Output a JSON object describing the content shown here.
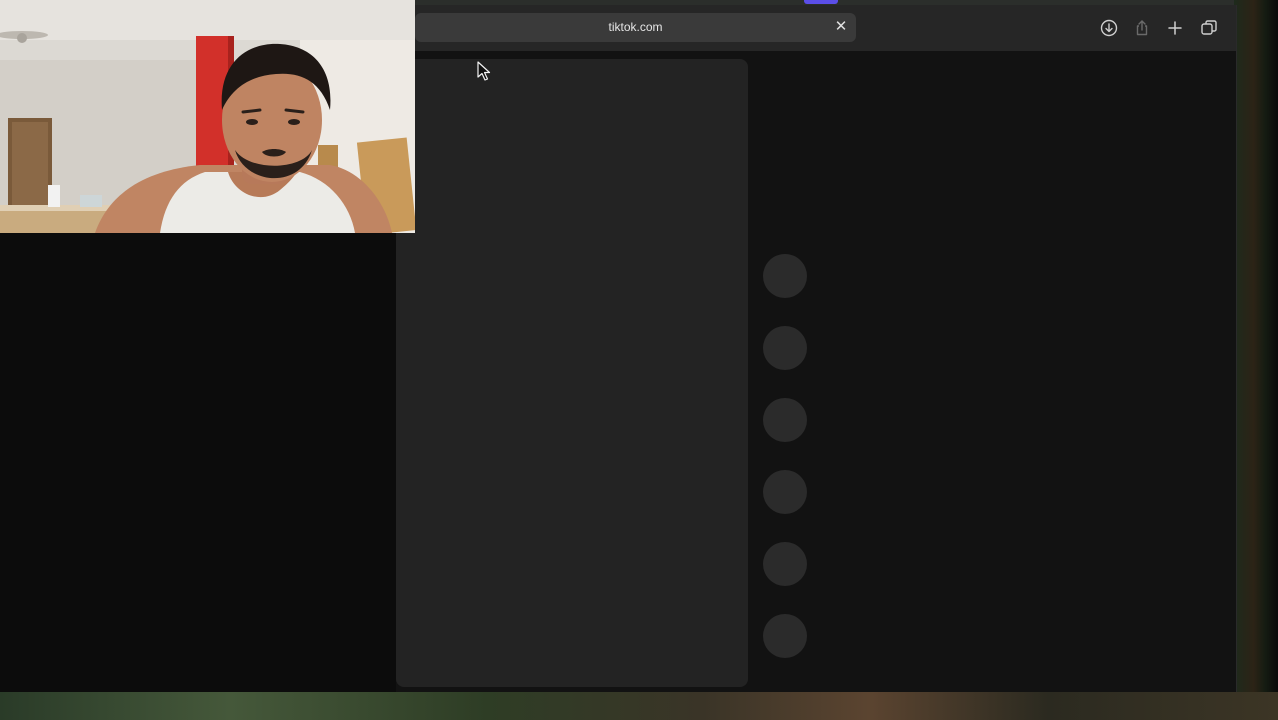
{
  "browser": {
    "tab": {
      "title": "tiktok.com",
      "close_glyph": "✕"
    },
    "toolbar_icons": [
      "download-icon",
      "share-icon",
      "plus-icon",
      "tabs-overview-icon"
    ]
  },
  "page": {
    "action_buttons": 6
  },
  "colors": {
    "toolbar_bg": "#262626",
    "tab_bg": "#3a3a3a",
    "page_bg": "#121212",
    "skeleton": "#232323",
    "accent": "#5b4ee8"
  }
}
